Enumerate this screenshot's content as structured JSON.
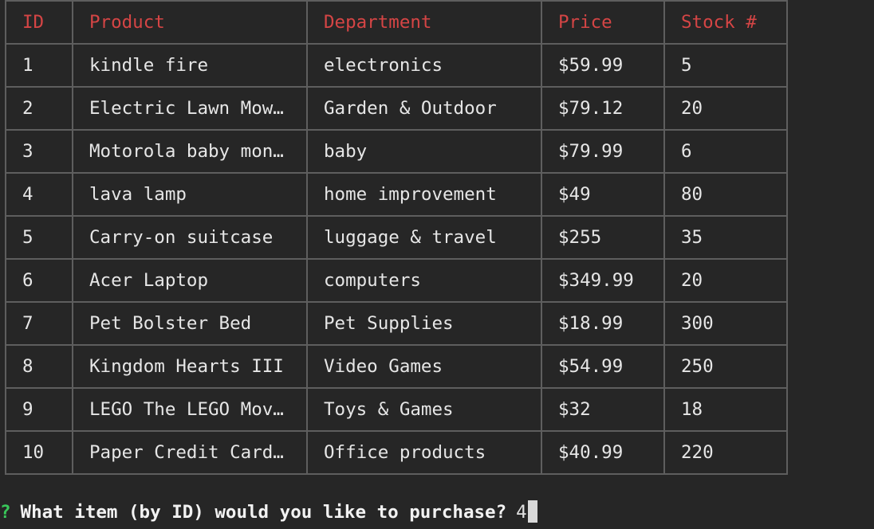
{
  "table": {
    "headers": {
      "id": "ID",
      "product": "Product",
      "department": "Department",
      "price": "Price",
      "stock": "Stock #"
    },
    "rows": [
      {
        "id": "1",
        "product": "kindle fire",
        "department": "electronics",
        "price": "$59.99",
        "stock": "5"
      },
      {
        "id": "2",
        "product": "Electric Lawn Mow…",
        "department": "Garden & Outdoor",
        "price": "$79.12",
        "stock": "20"
      },
      {
        "id": "3",
        "product": "Motorola baby mon…",
        "department": "baby",
        "price": "$79.99",
        "stock": "6"
      },
      {
        "id": "4",
        "product": "lava lamp",
        "department": "home improvement",
        "price": "$49",
        "stock": "80"
      },
      {
        "id": "5",
        "product": "Carry-on suitcase",
        "department": "luggage & travel",
        "price": "$255",
        "stock": "35"
      },
      {
        "id": "6",
        "product": "Acer Laptop",
        "department": "computers",
        "price": "$349.99",
        "stock": "20"
      },
      {
        "id": "7",
        "product": "Pet Bolster Bed",
        "department": "Pet Supplies",
        "price": "$18.99",
        "stock": "300"
      },
      {
        "id": "8",
        "product": "Kingdom Hearts III",
        "department": "Video Games",
        "price": "$54.99",
        "stock": "250"
      },
      {
        "id": "9",
        "product": "LEGO The LEGO Mov…",
        "department": "Toys & Games",
        "price": "$32",
        "stock": "18"
      },
      {
        "id": "10",
        "product": "Paper Credit Card…",
        "department": "Office products",
        "price": "$40.99",
        "stock": "220"
      }
    ]
  },
  "prompt": {
    "marker": "?",
    "question": "What item (by ID) would you like to purchase?",
    "answer": "4"
  },
  "colors": {
    "background": "#262626",
    "header_text": "#d54545",
    "prompt_marker": "#39c75a",
    "border": "#5e5e5e"
  }
}
